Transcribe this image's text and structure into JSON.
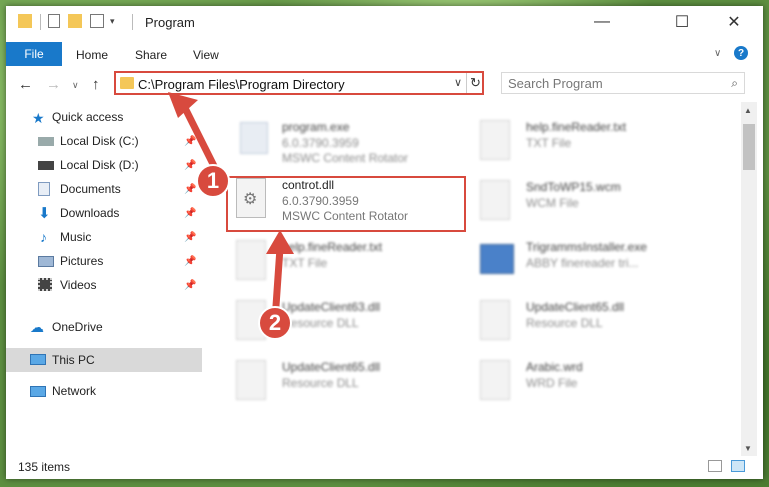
{
  "window": {
    "title": "Program",
    "minimize": "—",
    "maximize": "☐",
    "close": "✕"
  },
  "ribbon": {
    "tabs": [
      "File",
      "Home",
      "Share",
      "View"
    ]
  },
  "address": {
    "path": "C:\\Program Files\\Program Directory",
    "search_placeholder": "Search Program"
  },
  "sidebar": {
    "items": [
      {
        "label": "Quick access",
        "pinned": false,
        "icon": "star-icon"
      },
      {
        "label": "Local Disk (C:)",
        "pinned": true,
        "icon": "drive-icon"
      },
      {
        "label": "Local Disk (D:)",
        "pinned": true,
        "icon": "drive-icon"
      },
      {
        "label": "Documents",
        "pinned": true,
        "icon": "documents-icon"
      },
      {
        "label": "Downloads",
        "pinned": true,
        "icon": "download-icon"
      },
      {
        "label": "Music",
        "pinned": true,
        "icon": "music-icon"
      },
      {
        "label": "Pictures",
        "pinned": true,
        "icon": "pictures-icon"
      },
      {
        "label": "Videos",
        "pinned": true,
        "icon": "videos-icon"
      },
      {
        "label": "OneDrive",
        "pinned": false,
        "icon": "cloud-icon"
      },
      {
        "label": "This PC",
        "pinned": false,
        "icon": "computer-icon"
      },
      {
        "label": "Network",
        "pinned": false,
        "icon": "network-icon"
      }
    ]
  },
  "files": [
    {
      "name": "program.exe",
      "line2": "6.0.3790.3959",
      "line3": "MSWC Content Rotator"
    },
    {
      "name": "help.fineReader.txt",
      "line2": "TXT File",
      "line3": ""
    },
    {
      "name": "controt.dll",
      "line2": "6.0.3790.3959",
      "line3": "MSWC Content Rotator"
    },
    {
      "name": "SndToWP15.wcm",
      "line2": "WCM File",
      "line3": ""
    },
    {
      "name": "help.fineReader.txt",
      "line2": "TXT File",
      "line3": ""
    },
    {
      "name": "TrigrammsInstaller.exe",
      "line2": "ABBY finereader tri...",
      "line3": ""
    },
    {
      "name": "UpdateClient63.dll",
      "line2": "Resource DLL",
      "line3": ""
    },
    {
      "name": "UpdateClient65.dll",
      "line2": "Resource DLL",
      "line3": ""
    },
    {
      "name": "UpdateClient65.dll",
      "line2": "Resource DLL",
      "line3": ""
    },
    {
      "name": "Arabic.wrd",
      "line2": "WRD File",
      "line3": ""
    }
  ],
  "status": {
    "count": "135 items"
  },
  "callouts": [
    "1",
    "2"
  ],
  "colors": {
    "accent": "#1979ca",
    "highlight": "#d84a3e"
  }
}
